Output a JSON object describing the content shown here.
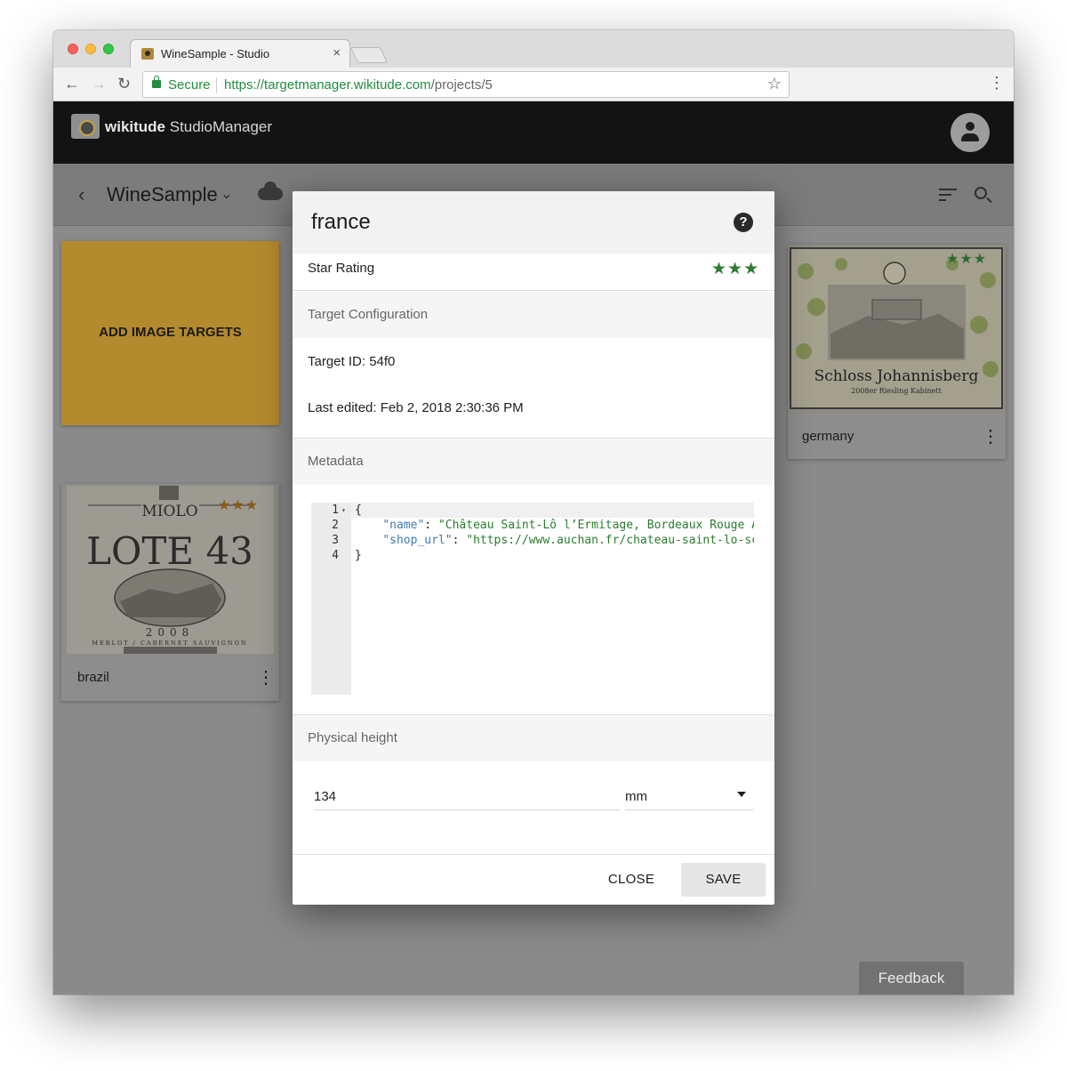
{
  "browser": {
    "tab_title": "WineSample - Studio",
    "tab_close": "×",
    "secure_label": "Secure",
    "url_host": "https://targetmanager.wikitude.com",
    "url_path": "/projects/5",
    "nav_back": "←",
    "nav_forward": "→",
    "nav_reload": "↻",
    "bookmark_star": "☆",
    "menu": "⋮"
  },
  "app": {
    "brand_bold": "wikitude",
    "brand_rest": "StudioManager",
    "project_back": "‹",
    "project_name": "WineSample",
    "project_chevron": "⌄",
    "feedback": "Feedback"
  },
  "cards": {
    "add_label": "ADD IMAGE TARGETS",
    "items": [
      {
        "name": "germany",
        "stars": "★★★",
        "menu": "⋮"
      },
      {
        "name": "brazil",
        "stars": "★★★",
        "menu": "⋮"
      }
    ],
    "brazil_label": {
      "brand": "MIOLO",
      "title": "LOTE 43",
      "year": "2008",
      "grapes": "MERLOT / CABERNET SAUVIGNON"
    },
    "germany_label": {
      "title": "Schloss Johannisberg",
      "sub": "2008er Riesling Kabinett"
    }
  },
  "dialog": {
    "title": "france",
    "help_icon": "?",
    "star_rating_label": "Star Rating",
    "star_rating_stars": "★★★",
    "star_rating_value": 3,
    "target_config_header": "Target Configuration",
    "target_id": "Target ID: 54f0",
    "last_edited": "Last edited: Feb 2, 2018 2:30:36 PM",
    "metadata_header": "Metadata",
    "editor": {
      "line_numbers": [
        "1",
        "2",
        "3",
        "4"
      ],
      "fold_marker": "▾",
      "line1": "{",
      "line2_key": "\"name\"",
      "line2_val": "\"Château Saint-Lô l’Ermitage, Bordeaux Rouge A",
      "line3_key": "\"shop_url\"",
      "line3_val": "\"https://www.auchan.fr/chateau-saint-lo-sc",
      "line4": "}"
    },
    "physical_height_header": "Physical height",
    "height_value": "134",
    "unit_value": "mm",
    "close_label": "CLOSE",
    "save_label": "SAVE"
  },
  "colors": {
    "star_green": "#2f7d32",
    "secure_green": "#1e8e3e",
    "add_card": "#b48a2e"
  }
}
